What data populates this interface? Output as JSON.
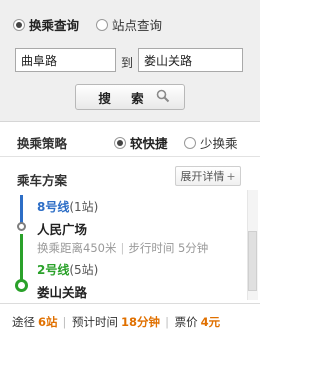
{
  "modes": {
    "transfer": "换乘查询",
    "station": "站点查询"
  },
  "search": {
    "from_value": "曲阜路",
    "to_label": "到",
    "to_value": "娄山关路",
    "button_label": "搜 索"
  },
  "strategy": {
    "title": "换乘策略",
    "options": [
      "较快捷",
      "少换乘"
    ],
    "selected": "较快捷"
  },
  "plan": {
    "title": "乘车方案",
    "expand_label": "展开详情",
    "expand_symbol": "+",
    "segments": [
      {
        "line": "8号线",
        "stops": "(1站)",
        "color": "#2d6ec6"
      },
      {
        "transfer_station": "人民广场"
      },
      {
        "transfer_info": {
          "distance": "换乘距离450米",
          "walk": "步行时间 5分钟"
        }
      },
      {
        "line": "2号线",
        "stops": "(5站)",
        "color": "#2aa12a"
      },
      {
        "end_station": "娄山关路"
      }
    ]
  },
  "summary": {
    "route_label": "途径",
    "route_value": "6站",
    "time_label": "预计时间",
    "time_value": "18分钟",
    "price_label": "票价",
    "price_value": "4元",
    "separator": "|"
  },
  "colors": {
    "accent_orange": "#e07000",
    "line8_blue": "#2d6ec6",
    "line2_green": "#2aa12a"
  }
}
